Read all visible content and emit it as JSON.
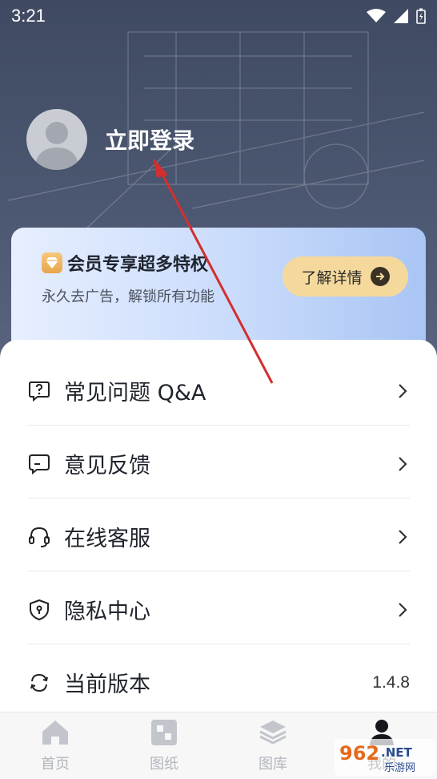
{
  "status_bar": {
    "time": "3:21",
    "icons": [
      "wifi-icon",
      "signal-icon",
      "battery-icon"
    ]
  },
  "profile": {
    "login_label": "立即登录",
    "avatar_icon": "user-avatar-icon"
  },
  "vip": {
    "title": "会员专享超多特权",
    "subtitle": "永久去广告，解锁所有功能",
    "button_label": "了解详情",
    "badge_icon": "diamond-icon",
    "button_icon": "arrow-right-icon"
  },
  "menu": {
    "items": [
      {
        "label": "常见问题 Q&A",
        "icon": "question-chat-icon"
      },
      {
        "label": "意见反馈",
        "icon": "chat-bubble-icon"
      },
      {
        "label": "在线客服",
        "icon": "headset-icon"
      },
      {
        "label": "隐私中心",
        "icon": "shield-icon"
      },
      {
        "label": "当前版本",
        "icon": "refresh-icon",
        "value": "1.4.8"
      }
    ]
  },
  "tabbar": {
    "tabs": [
      {
        "label": "首页",
        "icon": "home-icon",
        "active": false
      },
      {
        "label": "图纸",
        "icon": "drawing-icon",
        "active": false
      },
      {
        "label": "图库",
        "icon": "layers-icon",
        "active": false
      },
      {
        "label": "我的",
        "icon": "person-icon",
        "active": true
      }
    ]
  },
  "watermark": {
    "text": "962.NET",
    "sub": "乐游网"
  },
  "colors": {
    "hero": "#4c5771",
    "vip_button": "#f5d99c",
    "annotation_arrow": "#d32f2f"
  }
}
